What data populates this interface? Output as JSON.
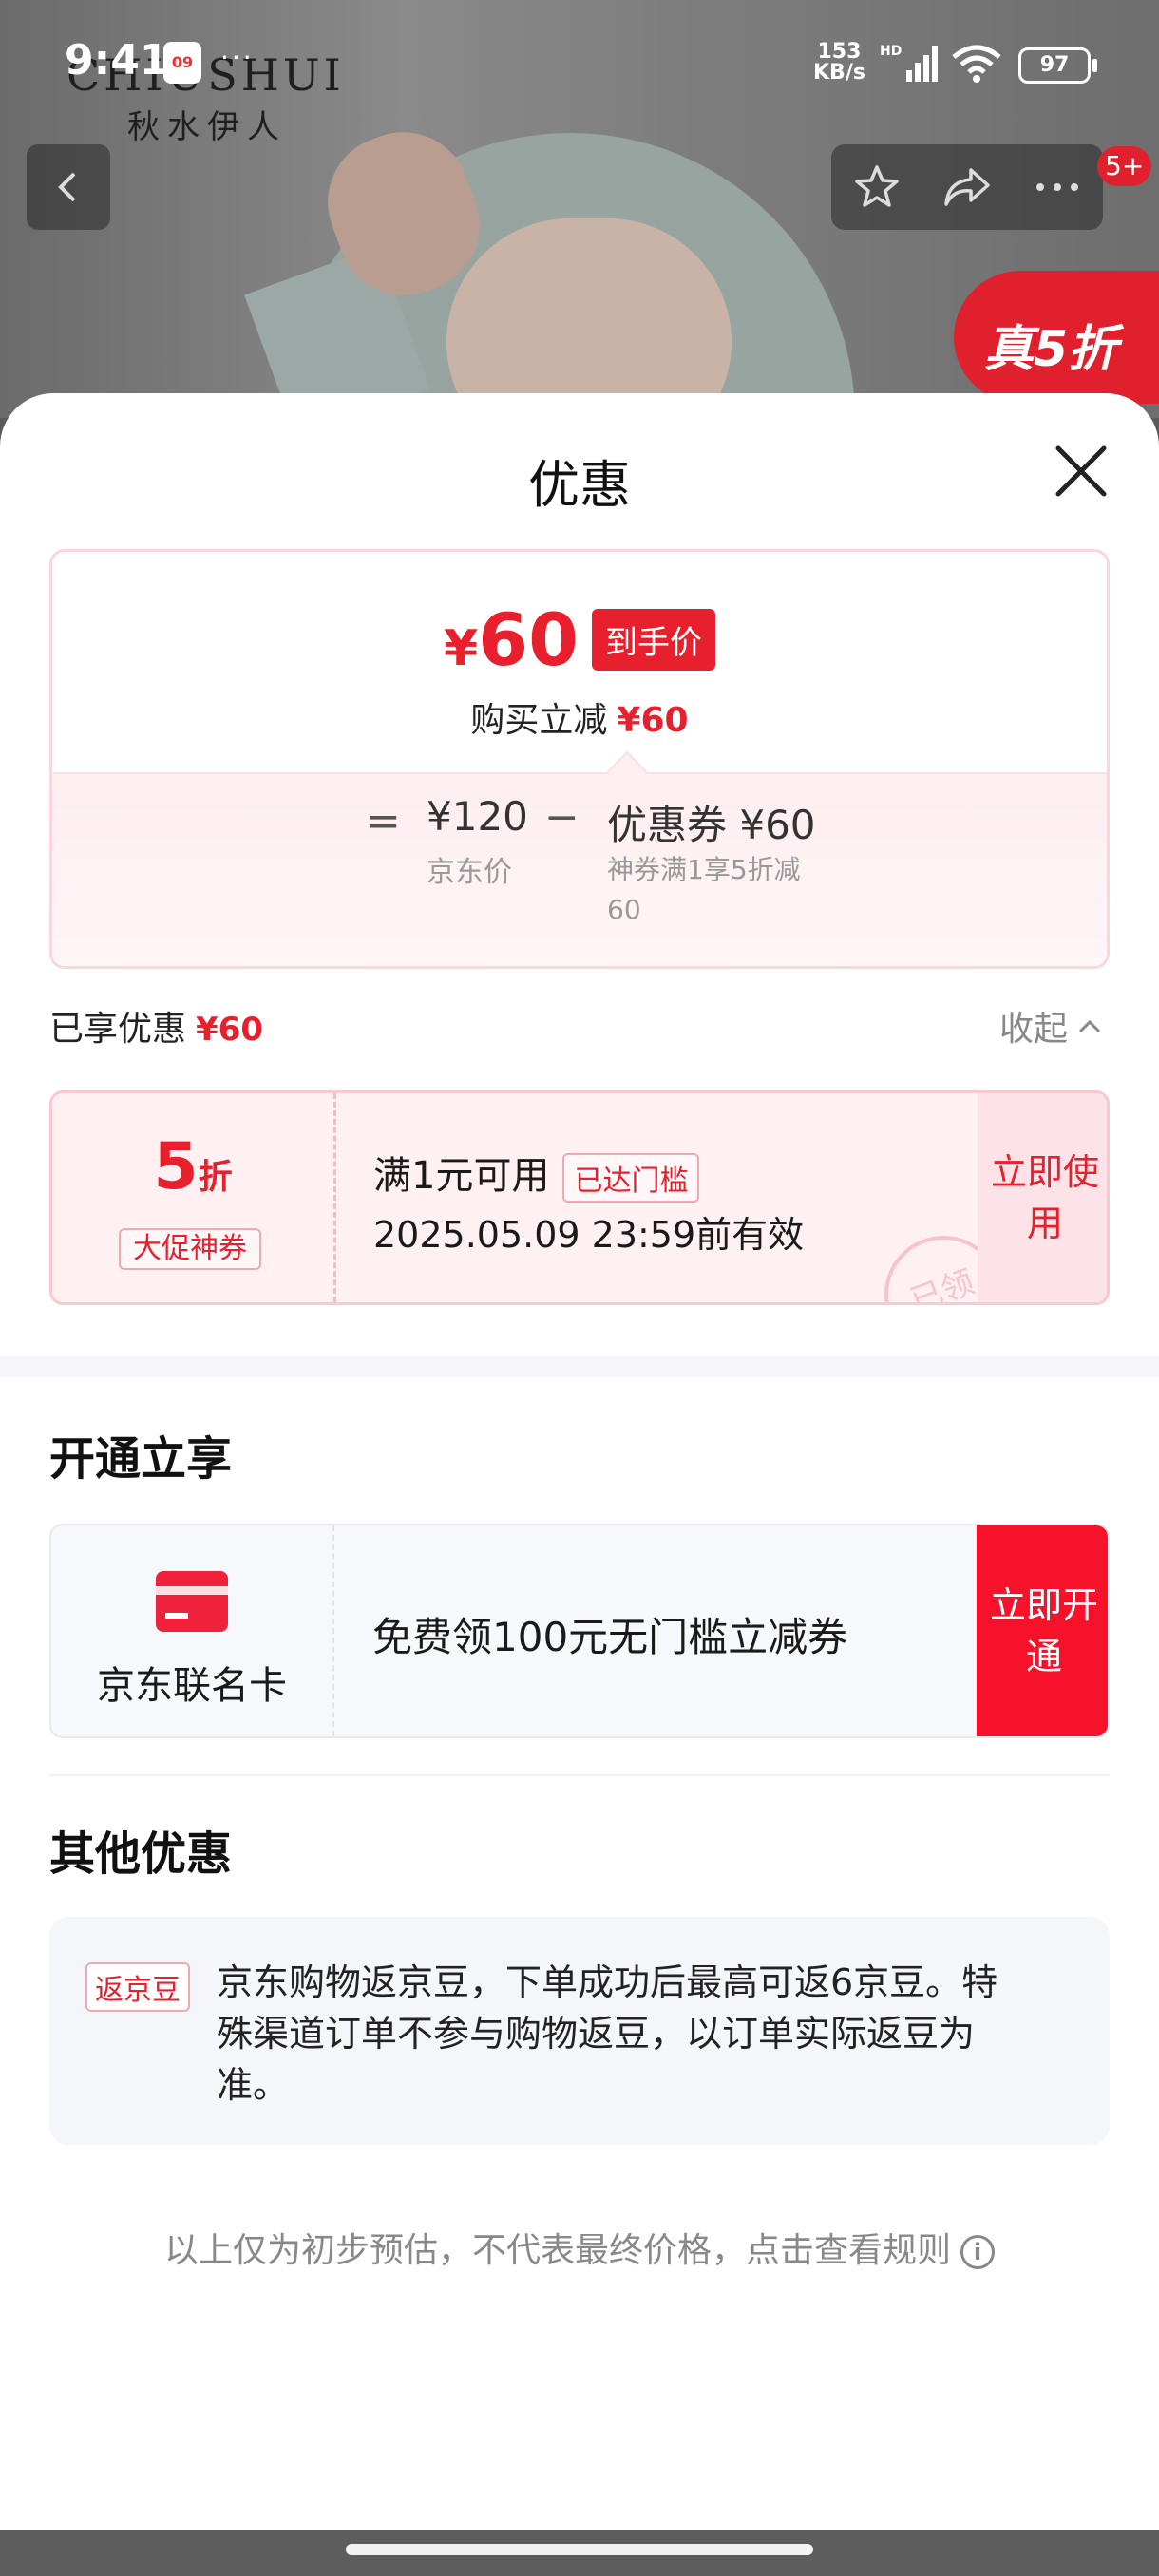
{
  "status_bar": {
    "time": "9:41",
    "calendar_day": "09",
    "more_dots": "···",
    "net_speed_value": "153",
    "net_speed_unit": "KB/s",
    "network_label": "HD",
    "battery": "97"
  },
  "background": {
    "brand_en": "CHIUSHUI",
    "brand_cn": "秋水伊人",
    "promo_badge": "真5折",
    "message_badge": "5+"
  },
  "sheet": {
    "title": "优惠",
    "price_card": {
      "final_currency": "¥",
      "final_price": "60",
      "final_tag": "到手价",
      "reduce_label": "购买立减",
      "reduce_amount": "¥60",
      "equals": "=",
      "jd_price": "¥120",
      "jd_price_label": "京东价",
      "minus": "−",
      "coupon_amount": "优惠券 ¥60",
      "coupon_desc": "神券满1享5折减60"
    },
    "enjoyed_label": "已享优惠",
    "enjoyed_amount": "¥60",
    "collapse_label": "收起",
    "coupon": {
      "discount_value": "5",
      "discount_unit": "折",
      "tag": "大促神券",
      "condition": "满1元可用",
      "reached_tag": "已达门槛",
      "expiry": "2025.05.09 23:59前有效",
      "stamp": "已领",
      "action": "立即使用"
    },
    "open_section": {
      "title": "开通立享",
      "card_name": "京东联名卡",
      "offer_text": "免费领100元无门槛立减券",
      "action": "立即开通"
    },
    "other_section": {
      "title": "其他优惠",
      "bean_tag": "返京豆",
      "bean_text": "京东购物返京豆，下单成功后最高可返6京豆。特殊渠道订单不参与购物返豆，以订单实际返豆为准。"
    },
    "footnote": "以上仅为初步预估，不代表最终价格，点击查看规则",
    "info_icon_glyph": "i"
  },
  "colors": {
    "accent_red": "#e8202e",
    "open_button_red": "#f5122a"
  }
}
